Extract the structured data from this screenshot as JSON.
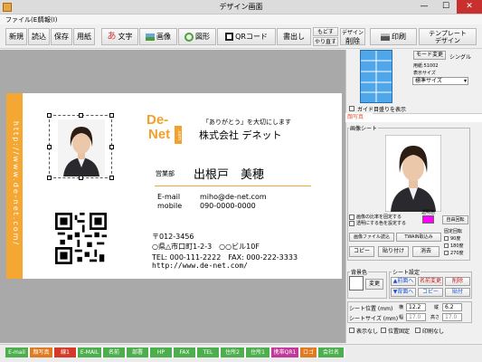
{
  "window": {
    "title": "デザイン画面",
    "min": "—",
    "max": "☐",
    "close": "✕"
  },
  "menu": [
    "ファイル(E)",
    "情報(I)"
  ],
  "toolbar": {
    "new": "新規",
    "open": "読込",
    "save": "保存",
    "paper": "用紙",
    "text_icon": "あ",
    "text": "文字",
    "image": "画像",
    "shape": "図形",
    "qr": "QRコード",
    "write": "書出し",
    "undo": "もどす",
    "redo": "やり直す",
    "design_top": "デザイン",
    "design_delete": "削除",
    "print": "印刷",
    "template_1": "テンプレート",
    "template_2": "デザイン"
  },
  "card": {
    "stripe_text": "http://www.de-net.com/",
    "logo_1": "De-",
    "logo_2": "Net",
    "logo_com": ".com",
    "tagline": "「ありがとう」を大切にします",
    "company": "株式会社 デネット",
    "dept": "営業部",
    "name": "出根戸　美穂",
    "email_label": "E-mail",
    "email": "miho@de-net.com",
    "mobile_label": "mobile",
    "mobile": "090-0000-0000",
    "zip": "〒012-3456",
    "address": "○県△市口町1-2-3　○○ビル10F",
    "tel": "TEL: 000-111-2222　FAX: 000-222-3333",
    "url": "http://www.de-net.com/"
  },
  "panel": {
    "mode_change": "モード変更",
    "mode": "シングル",
    "paper": "用紙:51002",
    "display_size": "表示サイズ",
    "size_value": "標準サイズ",
    "guide": "ガイド目盛りを表示",
    "tab": "顔写真",
    "sheet_label": "画像シート",
    "trans_color": "透明色",
    "keep_ratio": "画像の比率を固定する",
    "trans_set": "透明にする色を設定する",
    "free_rotate": "自由回転",
    "file_load": "画像ファイル読込",
    "twain": "TWAIN取込み",
    "copy": "コピー",
    "paste": "貼り付け",
    "delete": "消去",
    "fixed_rotate": "固定回転",
    "r90": "90度",
    "r180": "180度",
    "r270": "270度",
    "bgcolor": "背景色",
    "change": "変更",
    "sheet_settings": "シート設定",
    "front": "▲前面へ",
    "back": "▼背面へ",
    "name_change": "名前変更",
    "copy2": "コピー",
    "delete2": "削除",
    "paste2": "貼付",
    "pos_label": "シート位置 (mm)",
    "w_lbl": "横",
    "h_lbl": "縦",
    "pos_x": "12.2",
    "pos_y": "6.2",
    "size_label": "シートサイズ (mm)",
    "width_lbl": "幅",
    "height_lbl": "高さ",
    "size_w": "17.0",
    "size_h": "17.0",
    "hide": "表示なし",
    "fix_pos": "位置固定",
    "no_print": "印刷なし"
  },
  "status_tags": [
    {
      "label": "E-mail",
      "color": "#4cae4c"
    },
    {
      "label": "顔写真",
      "color": "#e07a20"
    },
    {
      "label": "線1",
      "color": "#d43a2a"
    },
    {
      "label": "E-MAIL",
      "color": "#4cae4c"
    },
    {
      "label": "名前",
      "color": "#4cae4c"
    },
    {
      "label": "部署",
      "color": "#4cae4c"
    },
    {
      "label": "HP",
      "color": "#4cae4c"
    },
    {
      "label": "FAX",
      "color": "#4cae4c"
    },
    {
      "label": "TEL",
      "color": "#4cae4c"
    },
    {
      "label": "住所2",
      "color": "#4cae4c"
    },
    {
      "label": "住所1",
      "color": "#4cae4c"
    },
    {
      "label": "携帯QR1",
      "color": "#c2389a"
    },
    {
      "label": "ロゴ",
      "color": "#e07a20"
    },
    {
      "label": "会社名",
      "color": "#4cae4c"
    }
  ],
  "colors": {
    "accent": "#f5a733",
    "tab_red": "#e05a3a"
  }
}
